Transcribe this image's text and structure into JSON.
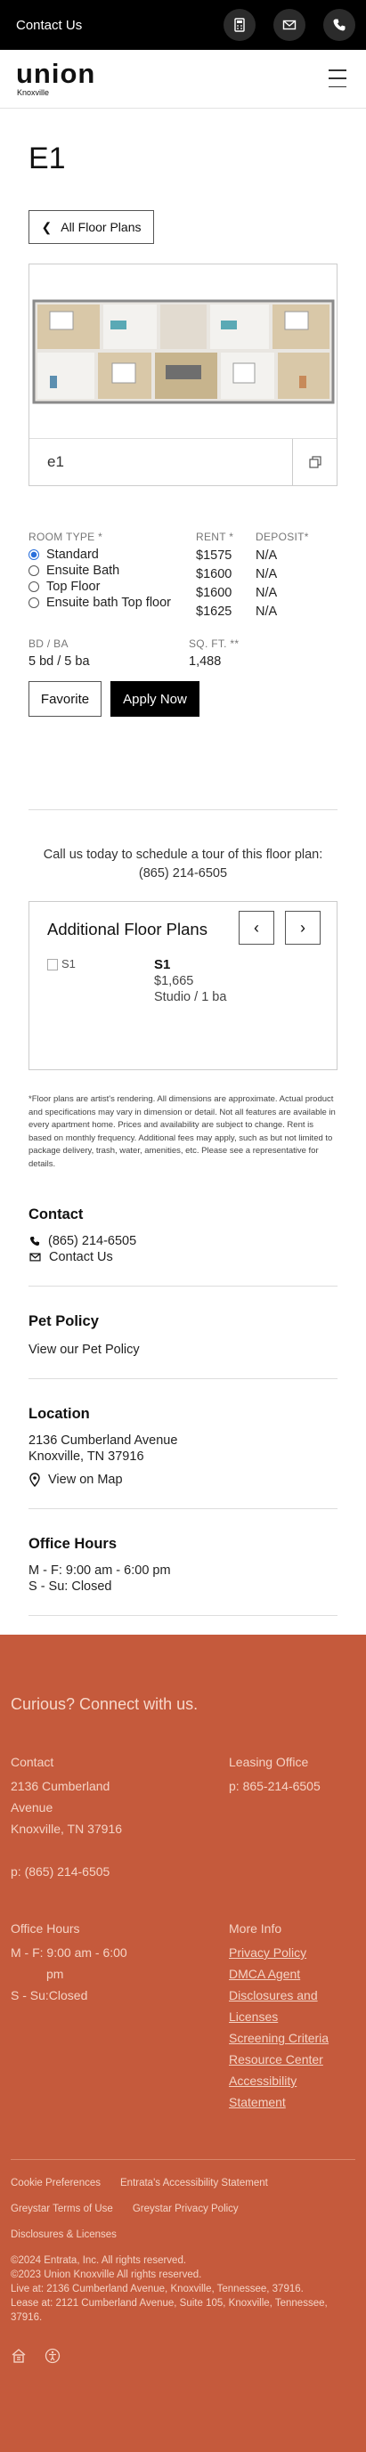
{
  "topbar": {
    "contact_label": "Contact Us"
  },
  "header": {
    "logo_word": "union",
    "logo_sub": "Knoxville"
  },
  "page": {
    "title": "E1",
    "back_label": "All Floor Plans"
  },
  "plan": {
    "name": "e1"
  },
  "types": {
    "room_type_label": "ROOM TYPE *",
    "rent_label": "RENT *",
    "deposit_label": "DEPOSIT*",
    "options": [
      {
        "label": "Standard",
        "rent": "$1575",
        "deposit": "N/A",
        "selected": true
      },
      {
        "label": "Ensuite Bath",
        "rent": "$1600",
        "deposit": "N/A",
        "selected": false
      },
      {
        "label": "Top Floor",
        "rent": "$1600",
        "deposit": "N/A",
        "selected": false
      },
      {
        "label": "Ensuite bath Top floor",
        "rent": "$1625",
        "deposit": "N/A",
        "selected": false
      }
    ]
  },
  "specs": {
    "bdba_label": "BD / BA",
    "bdba_value": "5 bd / 5 ba",
    "sqft_label": "SQ. FT. **",
    "sqft_value": "1,488"
  },
  "actions": {
    "favorite": "Favorite",
    "apply": "Apply Now"
  },
  "call": {
    "line1": "Call us today to schedule a tour of this floor plan:",
    "phone": "(865) 214-6505"
  },
  "additional": {
    "title": "Additional Floor Plans",
    "items": [
      {
        "img_alt": "S1",
        "name": "S1",
        "price": "$1,665",
        "type": "Studio / 1 ba"
      }
    ]
  },
  "disclaimer": "*Floor plans are artist's rendering. All dimensions are approximate. Actual product and specifications may vary in dimension or detail. Not all features are available in every apartment home. Prices and availability are subject to change. Rent is based on monthly frequency. Additional fees may apply, such as but not limited to package delivery, trash, water, amenities, etc. Please see a representative for details.",
  "contact": {
    "heading": "Contact",
    "phone": "(865) 214-6505",
    "link": "Contact Us"
  },
  "pet": {
    "heading": "Pet Policy",
    "link": "View our Pet Policy"
  },
  "location": {
    "heading": "Location",
    "line1": "2136 Cumberland Avenue",
    "line2": "Knoxville, TN 37916",
    "map": "View on Map"
  },
  "hours": {
    "heading": "Office Hours",
    "line1": "M - F:  9:00 am - 6:00 pm",
    "line2": "S - Su:  Closed"
  },
  "footer": {
    "curious": "Curious? Connect with us.",
    "contact_h": "Contact",
    "addr1": "2136 Cumberland",
    "addr2": "Avenue",
    "addr3": "Knoxville, TN 37916",
    "phone": "p: (865) 214-6505",
    "leasing_h": "Leasing Office",
    "leasing_phone": "p: 865-214-6505",
    "hours_h": "Office Hours",
    "hours1": "M - F: 9:00 am - 6:00",
    "hours1b": "pm",
    "hours2": "S - Su:Closed",
    "more_h": "More Info",
    "more": [
      "Privacy Policy",
      "DMCA Agent",
      "Disclosures and Licenses",
      "Screening Criteria",
      "Resource Center",
      "Accessibility Statement"
    ],
    "cookie": "Cookie Preferences",
    "access": "Entrata's Accessibility Statement",
    "terms": "Greystar Terms of Use",
    "privacy": "Greystar Privacy Policy",
    "disclosures": "Disclosures & Licenses",
    "copy1": "©2024 Entrata, Inc. All rights reserved.",
    "copy2": "©2023 Union Knoxville All rights reserved.",
    "live": "Live at: 2136 Cumberland Avenue, Knoxville, Tennessee, 37916.",
    "lease": "Lease at: 2121 Cumberland Avenue, Suite 105, Knoxville, Tennessee, 37916."
  }
}
